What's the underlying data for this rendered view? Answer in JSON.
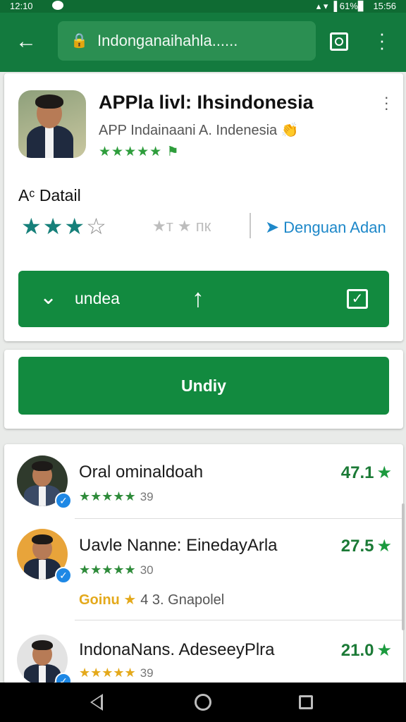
{
  "status_bar": {
    "time": "12:10",
    "right_text": "▴ ▾ ▐ 61%▊",
    "clock_right": "15:56"
  },
  "toolbar": {
    "url": "Indonganaihahla......",
    "back_icon": "arrow-back-icon",
    "tabs_icon": "tab-switcher-icon",
    "menu_icon": "more-vert-icon"
  },
  "app": {
    "title": "APPla livl: Ihsindonesia",
    "subtitle": "APP Indainaani A. Indenesia",
    "subtitle_emoji": "👏",
    "stars": "★★★★★ ⚑",
    "more_icon": "more-vert-icon"
  },
  "detail": {
    "label": "Aᶜ Datail",
    "stars_filled": "★★★",
    "stars_empty": "☆",
    "muted_text": "★т ★ пк",
    "link_text": "Denguan Adan",
    "link_icon": "arrow-right-icon"
  },
  "buttons": {
    "main_label": "undea",
    "main_chevron": "⌄",
    "main_up": "↑",
    "main_check": "✓",
    "second_label": "Undiy"
  },
  "reviews": [
    {
      "name": "Oral ominaldoah",
      "stars": "★★★★★",
      "count": "39",
      "score": "47.1",
      "star": "★",
      "avatar_bg": "#2f3a2c"
    },
    {
      "name": "Uavle Nanne: EinedayArla",
      "stars": "★★★★★",
      "count": "30",
      "score": "27.5",
      "star": "★",
      "avatar_bg": "#e8a43a",
      "extra_gold": "Goinu ★",
      "extra_rest": "4 3. Gnapolel"
    },
    {
      "name": "IndonaNans. AdeseeyPlra",
      "stars": "★★★★★",
      "count": "39",
      "score": "21.0",
      "star": "★",
      "avatar_bg": "#e3e3e3"
    }
  ],
  "colors": {
    "brand_green": "#137a3e",
    "button_green": "#128a3f",
    "star_teal": "#16807a",
    "link_blue": "#1e88c9"
  }
}
